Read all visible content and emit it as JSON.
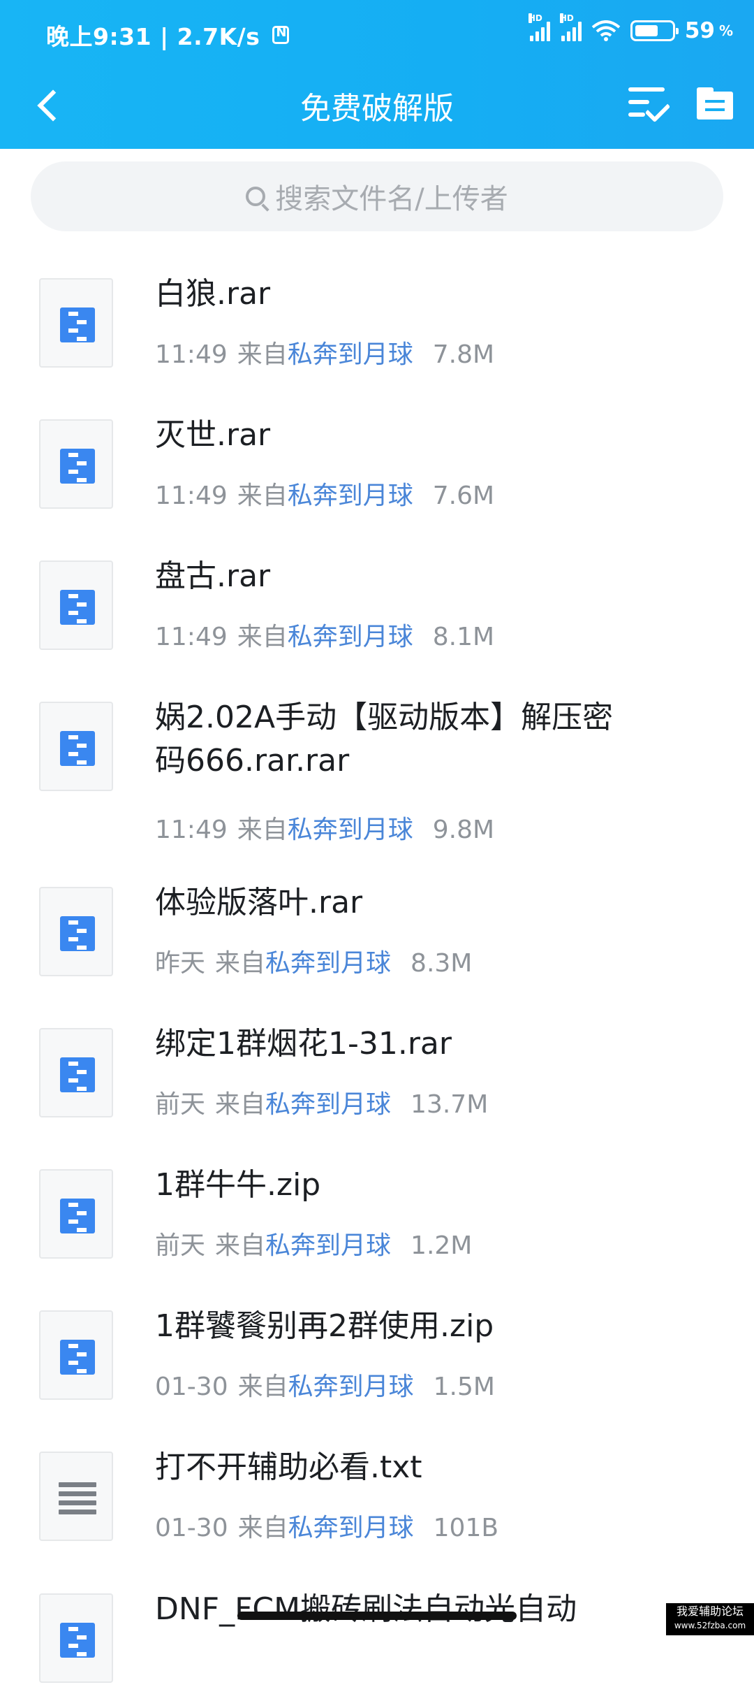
{
  "status_bar": {
    "time": "晚上9:31 | 2.7K/s",
    "signal1_label": "HD",
    "signal2_label": "HD",
    "battery_percent": "59",
    "percent_sign": "%"
  },
  "nav": {
    "title": "免费破解版"
  },
  "search": {
    "placeholder": "搜索文件名/上传者"
  },
  "files": [
    {
      "name": "白狼.rar",
      "time": "11:49",
      "from_label": "来自",
      "source": "私奔到月球",
      "size": "7.8M",
      "type": "zip"
    },
    {
      "name": "灭世.rar",
      "time": "11:49",
      "from_label": "来自",
      "source": "私奔到月球",
      "size": "7.6M",
      "type": "zip"
    },
    {
      "name": "盘古.rar",
      "time": "11:49",
      "from_label": "来自",
      "source": "私奔到月球",
      "size": "8.1M",
      "type": "zip"
    },
    {
      "name": "娲2.02A手动【驱动版本】解压密码666.rar.rar",
      "time": "11:49",
      "from_label": "来自",
      "source": "私奔到月球",
      "size": "9.8M",
      "type": "zip"
    },
    {
      "name": "体验版落叶.rar",
      "time": "昨天",
      "from_label": "来自",
      "source": "私奔到月球",
      "size": "8.3M",
      "type": "zip"
    },
    {
      "name": "绑定1群烟花1-31.rar",
      "time": "前天",
      "from_label": "来自",
      "source": "私奔到月球",
      "size": "13.7M",
      "type": "zip"
    },
    {
      "name": "1群牛牛.zip",
      "time": "前天",
      "from_label": "来自",
      "source": "私奔到月球",
      "size": "1.2M",
      "type": "zip"
    },
    {
      "name": "1群饕餮别再2群使用.zip",
      "time": "01-30",
      "from_label": "来自",
      "source": "私奔到月球",
      "size": "1.5M",
      "type": "zip"
    },
    {
      "name": "打不开辅助必看.txt",
      "time": "01-30",
      "from_label": "来自",
      "source": "私奔到月球",
      "size": "101B",
      "type": "txt"
    },
    {
      "name": "DNF_FCM搬砖刷法自动光自动",
      "time": "",
      "from_label": "",
      "source": "",
      "size": "",
      "type": "zip"
    }
  ],
  "watermark": {
    "title": "我爱辅助论坛",
    "url": "www.52fzba.com"
  },
  "colors": {
    "header": "#17aef3",
    "link": "#4a86d8",
    "zip_icon": "#3a87f0"
  }
}
